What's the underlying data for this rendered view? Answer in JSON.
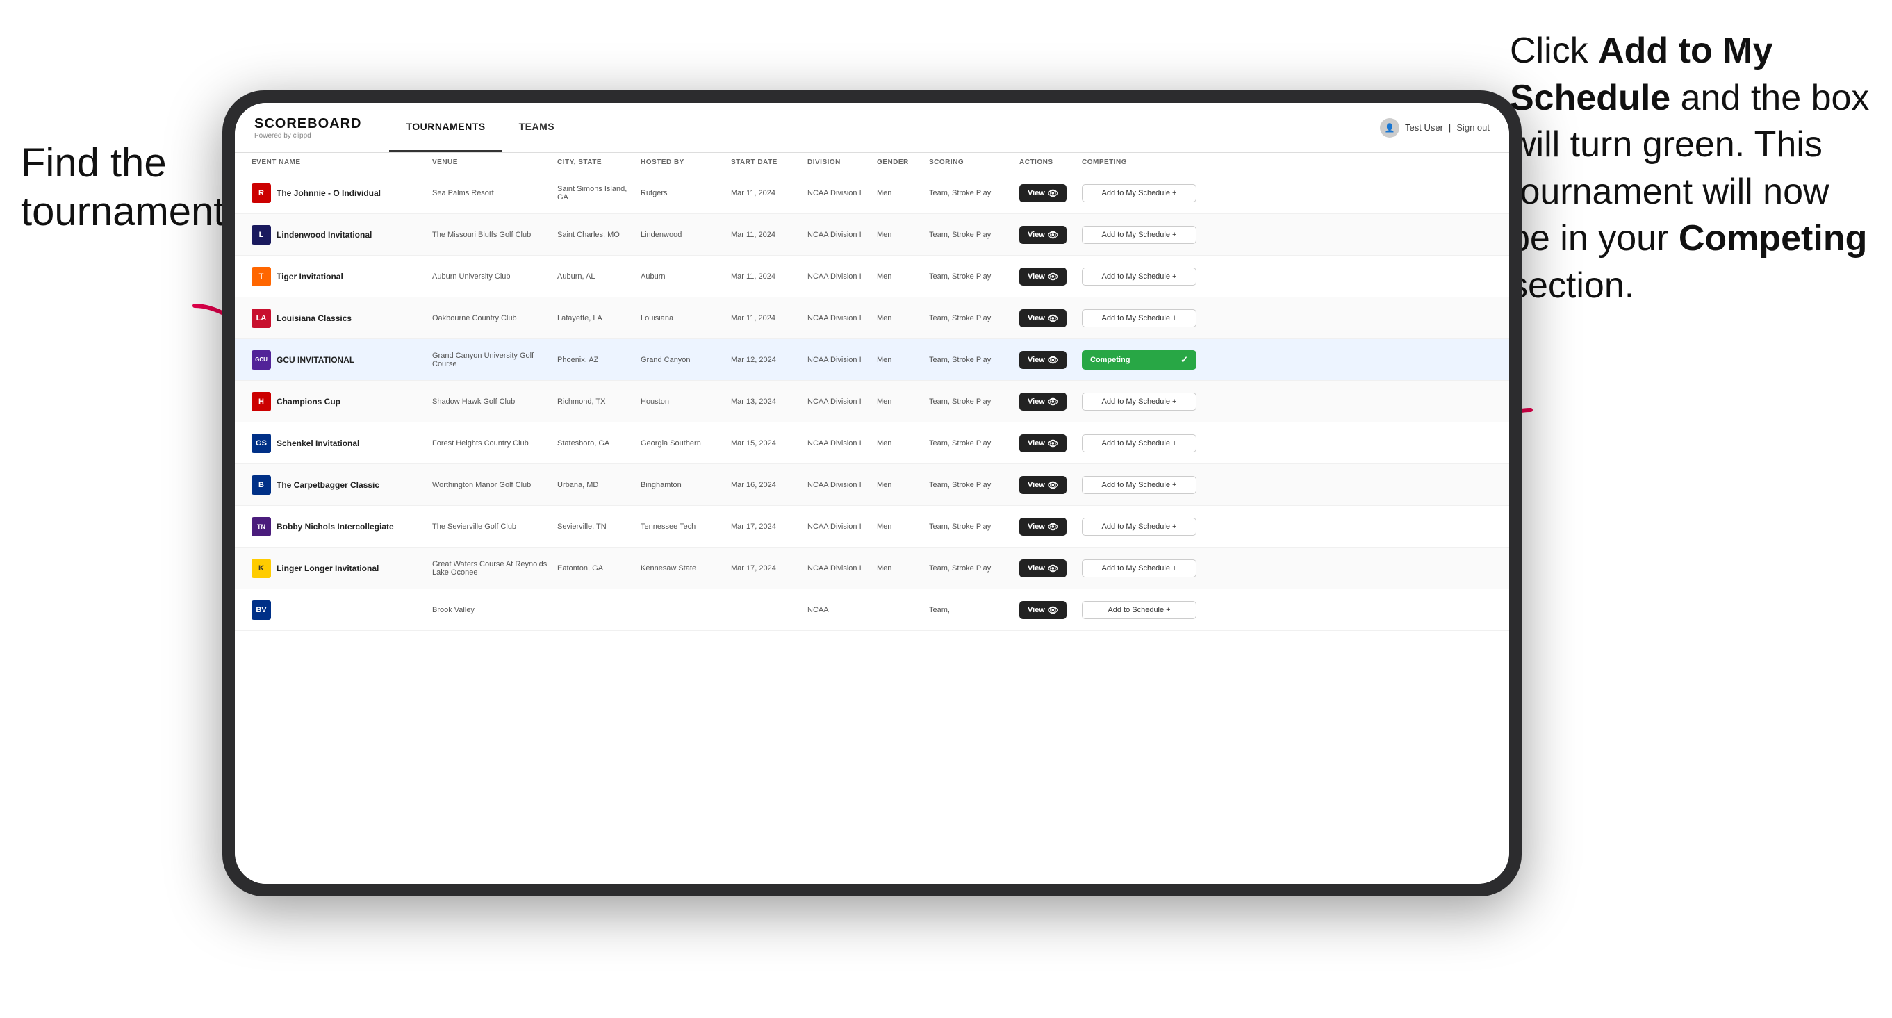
{
  "annotations": {
    "left": "Find the tournament.",
    "right_part1": "Click ",
    "right_bold1": "Add to My Schedule",
    "right_part2": " and the box will turn green. This tournament will now be in your ",
    "right_bold2": "Competing",
    "right_part3": " section."
  },
  "app": {
    "logo": "SCOREBOARD",
    "powered_by": "Powered by clippd",
    "nav": [
      "TOURNAMENTS",
      "TEAMS"
    ],
    "active_nav": "TOURNAMENTS",
    "user": "Test User",
    "sign_out": "Sign out"
  },
  "table": {
    "columns": [
      "EVENT NAME",
      "VENUE",
      "CITY, STATE",
      "HOSTED BY",
      "START DATE",
      "DIVISION",
      "GENDER",
      "SCORING",
      "ACTIONS",
      "COMPETING"
    ],
    "rows": [
      {
        "logo": "R",
        "logo_class": "logo-r",
        "name": "The Johnnie - O Individual",
        "venue": "Sea Palms Resort",
        "city_state": "Saint Simons Island, GA",
        "hosted_by": "Rutgers",
        "start_date": "Mar 11, 2024",
        "division": "NCAA Division I",
        "gender": "Men",
        "scoring": "Team, Stroke Play",
        "action": "View",
        "competing_label": "Add to My Schedule +",
        "is_competing": false,
        "highlighted": false
      },
      {
        "logo": "L",
        "logo_class": "logo-l",
        "name": "Lindenwood Invitational",
        "venue": "The Missouri Bluffs Golf Club",
        "city_state": "Saint Charles, MO",
        "hosted_by": "Lindenwood",
        "start_date": "Mar 11, 2024",
        "division": "NCAA Division I",
        "gender": "Men",
        "scoring": "Team, Stroke Play",
        "action": "View",
        "competing_label": "Add to My Schedule +",
        "is_competing": false,
        "highlighted": false
      },
      {
        "logo": "T",
        "logo_class": "logo-t",
        "name": "Tiger Invitational",
        "venue": "Auburn University Club",
        "city_state": "Auburn, AL",
        "hosted_by": "Auburn",
        "start_date": "Mar 11, 2024",
        "division": "NCAA Division I",
        "gender": "Men",
        "scoring": "Team, Stroke Play",
        "action": "View",
        "competing_label": "Add to My Schedule +",
        "is_competing": false,
        "highlighted": false
      },
      {
        "logo": "LA",
        "logo_class": "logo-la",
        "name": "Louisiana Classics",
        "venue": "Oakbourne Country Club",
        "city_state": "Lafayette, LA",
        "hosted_by": "Louisiana",
        "start_date": "Mar 11, 2024",
        "division": "NCAA Division I",
        "gender": "Men",
        "scoring": "Team, Stroke Play",
        "action": "View",
        "competing_label": "Add to My Schedule +",
        "is_competing": false,
        "highlighted": false
      },
      {
        "logo": "GCU",
        "logo_class": "logo-gcu",
        "name": "GCU INVITATIONAL",
        "venue": "Grand Canyon University Golf Course",
        "city_state": "Phoenix, AZ",
        "hosted_by": "Grand Canyon",
        "start_date": "Mar 12, 2024",
        "division": "NCAA Division I",
        "gender": "Men",
        "scoring": "Team, Stroke Play",
        "action": "View",
        "competing_label": "Competing",
        "is_competing": true,
        "highlighted": true
      },
      {
        "logo": "H",
        "logo_class": "logo-h",
        "name": "Champions Cup",
        "venue": "Shadow Hawk Golf Club",
        "city_state": "Richmond, TX",
        "hosted_by": "Houston",
        "start_date": "Mar 13, 2024",
        "division": "NCAA Division I",
        "gender": "Men",
        "scoring": "Team, Stroke Play",
        "action": "View",
        "competing_label": "Add to My Schedule +",
        "is_competing": false,
        "highlighted": false
      },
      {
        "logo": "GS",
        "logo_class": "logo-gs",
        "name": "Schenkel Invitational",
        "venue": "Forest Heights Country Club",
        "city_state": "Statesboro, GA",
        "hosted_by": "Georgia Southern",
        "start_date": "Mar 15, 2024",
        "division": "NCAA Division I",
        "gender": "Men",
        "scoring": "Team, Stroke Play",
        "action": "View",
        "competing_label": "Add to My Schedule +",
        "is_competing": false,
        "highlighted": false
      },
      {
        "logo": "B",
        "logo_class": "logo-b",
        "name": "The Carpetbagger Classic",
        "venue": "Worthington Manor Golf Club",
        "city_state": "Urbana, MD",
        "hosted_by": "Binghamton",
        "start_date": "Mar 16, 2024",
        "division": "NCAA Division I",
        "gender": "Men",
        "scoring": "Team, Stroke Play",
        "action": "View",
        "competing_label": "Add to My Schedule +",
        "is_competing": false,
        "highlighted": false
      },
      {
        "logo": "TN",
        "logo_class": "logo-tn",
        "name": "Bobby Nichols Intercollegiate",
        "venue": "The Sevierville Golf Club",
        "city_state": "Sevierville, TN",
        "hosted_by": "Tennessee Tech",
        "start_date": "Mar 17, 2024",
        "division": "NCAA Division I",
        "gender": "Men",
        "scoring": "Team, Stroke Play",
        "action": "View",
        "competing_label": "Add to My Schedule +",
        "is_competing": false,
        "highlighted": false
      },
      {
        "logo": "K",
        "logo_class": "logo-k",
        "name": "Linger Longer Invitational",
        "venue": "Great Waters Course At Reynolds Lake Oconee",
        "city_state": "Eatonton, GA",
        "hosted_by": "Kennesaw State",
        "start_date": "Mar 17, 2024",
        "division": "NCAA Division I",
        "gender": "Men",
        "scoring": "Team, Stroke Play",
        "action": "View",
        "competing_label": "Add to My Schedule +",
        "is_competing": false,
        "highlighted": false
      },
      {
        "logo": "BV",
        "logo_class": "logo-b",
        "name": "",
        "venue": "Brook Valley",
        "city_state": "",
        "hosted_by": "",
        "start_date": "",
        "division": "NCAA",
        "gender": "",
        "scoring": "Team,",
        "action": "View",
        "competing_label": "Add to Schedule +",
        "is_competing": false,
        "highlighted": false
      }
    ]
  }
}
